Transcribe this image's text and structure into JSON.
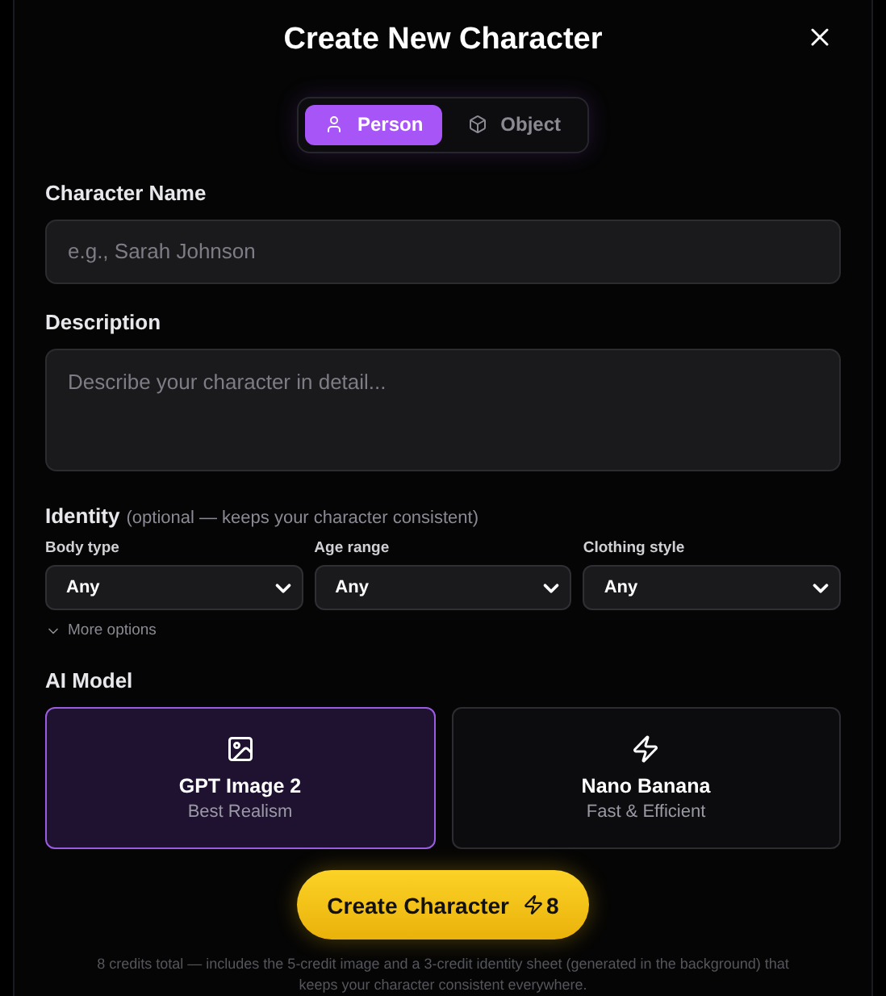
{
  "dialog": {
    "title": "Create New Character"
  },
  "type_toggle": [
    {
      "label": "Person",
      "kind": "person",
      "selected": true
    },
    {
      "label": "Object",
      "kind": "object",
      "selected": false
    }
  ],
  "name_field": {
    "label": "Character Name",
    "placeholder": "e.g., Sarah Johnson"
  },
  "description_field": {
    "label": "Description",
    "placeholder": "Describe your character in detail..."
  },
  "identity": {
    "label": "Identity",
    "hint": "(optional — keeps your character consistent)",
    "selects": [
      {
        "label": "Body type",
        "value": "Any"
      },
      {
        "label": "Age range",
        "value": "Any"
      },
      {
        "label": "Clothing style",
        "value": "Any"
      }
    ],
    "more_options": "More options"
  },
  "ai_model": {
    "label": "AI Model",
    "options": [
      {
        "name": "GPT Image 2",
        "subtitle": "Best Realism",
        "kind": "image",
        "selected": true
      },
      {
        "name": "Nano Banana",
        "subtitle": "Fast & Efficient",
        "kind": "bolt",
        "selected": false
      }
    ]
  },
  "create_button": {
    "label": "Create Character",
    "cost": "8"
  },
  "footnote": "8 credits total — includes the 5-credit image and a 3-credit identity sheet (generated in the background) that keeps your character consistent everywhere."
}
